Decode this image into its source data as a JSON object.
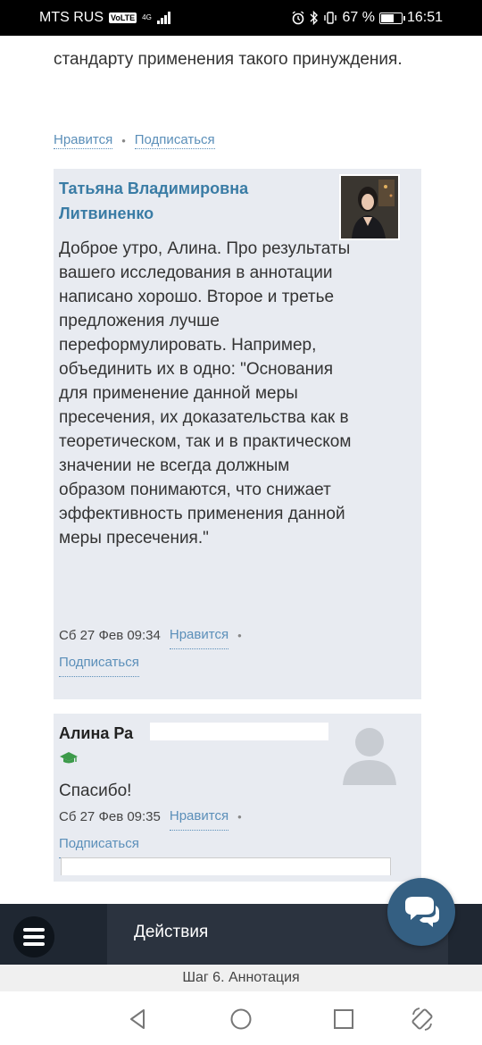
{
  "status": {
    "carrier": "MTS RUS",
    "volte": "VoLTE",
    "net": "4G",
    "battery_pct": "67 %",
    "battery_level": 0.67,
    "time": "16:51"
  },
  "post": {
    "text": "стандарту применения такого принуждения.",
    "like_label": "Нравится",
    "subscribe_label": "Подписаться"
  },
  "comments": [
    {
      "author": "Татьяна Владимировна Литвиненко",
      "text": "Доброе утро, Алина. Про результаты вашего исследования в аннотации написано хорошо. Второе и третье предложения лучше переформулировать. Например, объединить их в одно: \"Основания для применение данной меры пресечения, их доказательства как в теоретическом, так и в практическом значении не всегда должным образом понимаются, что снижает эффективность применения данной меры пресечения.\"",
      "date": "Сб 27 Фев 09:34",
      "like_label": "Нравится",
      "subscribe_label": "Подписаться"
    },
    {
      "author": "Алина Ра",
      "text": "Спасибо!",
      "date": "Сб 27 Фев 09:35",
      "like_label": "Нравится",
      "subscribe_label": "Подписаться"
    }
  ],
  "bottom": {
    "actions_label": "Действия",
    "step_label": "Шаг 6. Аннотация"
  },
  "colors": {
    "link": "#5b8fb9",
    "author_blue": "#3a7ca5",
    "comment_bg": "#e8ebf1",
    "bar_dark": "#1f2732",
    "fab": "#345f82",
    "grad_green": "#3c9a4a"
  }
}
